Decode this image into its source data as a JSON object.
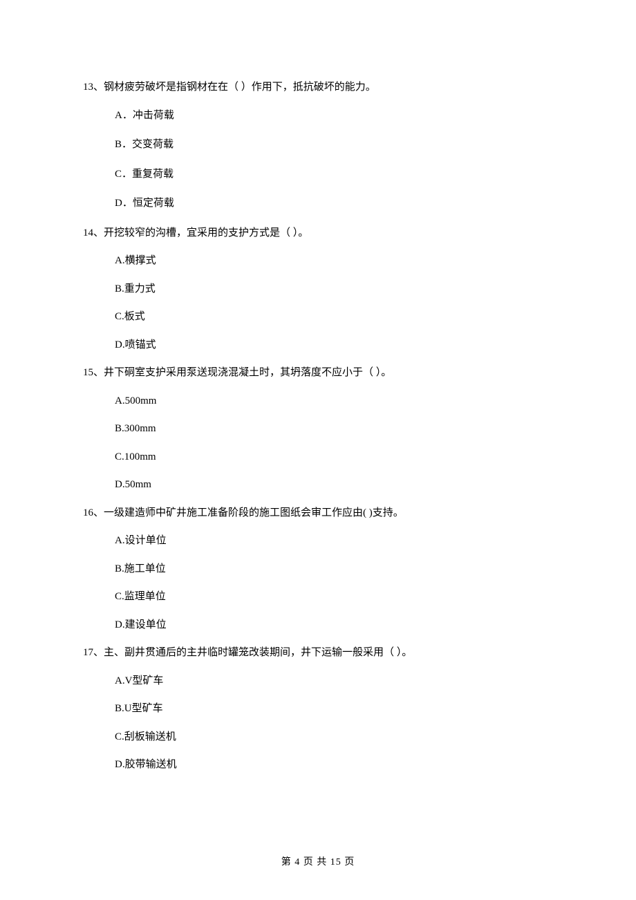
{
  "questions": [
    {
      "number": "13、",
      "stem": "钢材疲劳破坏是指钢材在在（    ）作用下，抵抗破坏的能力。",
      "options": [
        "A．冲击荷载",
        "B．交变荷载",
        "C．重复荷载",
        "D．恒定荷载"
      ]
    },
    {
      "number": "14、",
      "stem": "开挖较窄的沟槽，宜采用的支护方式是（    ）。",
      "options": [
        "A.横撑式",
        "B.重力式",
        "C.板式",
        "D.喷锚式"
      ]
    },
    {
      "number": "15、",
      "stem": "井下硐室支护采用泵送现浇混凝土时，其坍落度不应小于（    ）。",
      "options": [
        "A.500mm",
        "B.300mm",
        "C.100mm",
        "D.50mm"
      ]
    },
    {
      "number": "16、",
      "stem": "一级建造师中矿井施工准备阶段的施工图纸会审工作应由(    )支持。",
      "options": [
        "A.设计单位",
        "B.施工单位",
        "C.监理单位",
        "D.建设单位"
      ]
    },
    {
      "number": "17、",
      "stem": "主、副井贯通后的主井临时罐笼改装期间，井下运输一般采用（    ）。",
      "options": [
        "A.V型矿车",
        "B.U型矿车",
        "C.刮板输送机",
        "D.胶带输送机"
      ]
    }
  ],
  "footer": "第 4 页 共 15 页"
}
